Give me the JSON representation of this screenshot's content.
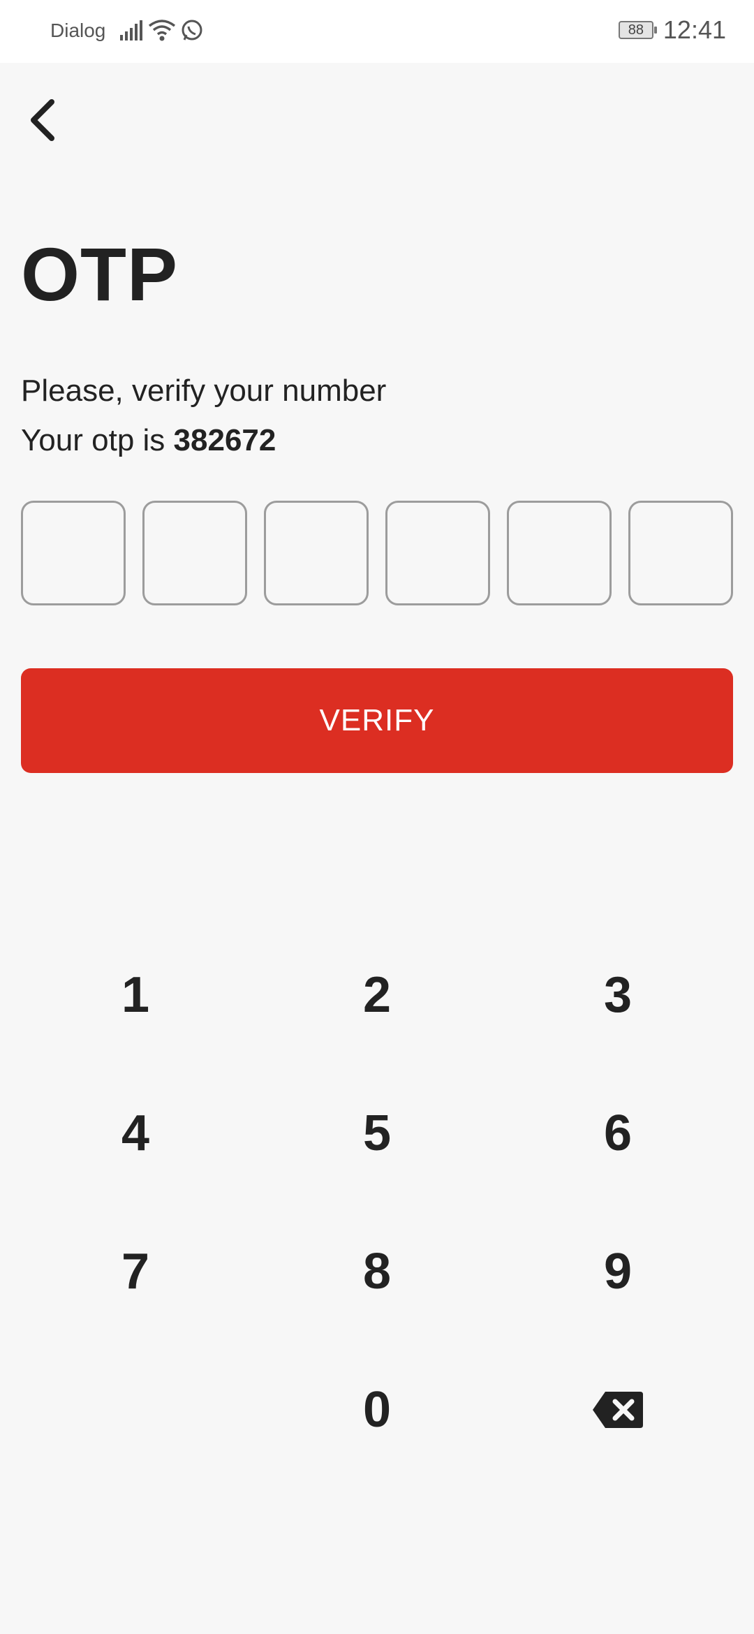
{
  "status_bar": {
    "carrier": "Dialog",
    "battery": "88",
    "time": "12:41",
    "icons": [
      "signal-icon",
      "wifi-icon",
      "whatsapp-icon"
    ]
  },
  "header": {
    "back_icon": "chevron-left-icon"
  },
  "main": {
    "title": "OTP",
    "subtitle": "Please, verify your number",
    "otp_prefix": "Your otp is ",
    "otp_code": "382672",
    "otp_boxes": [
      "",
      "",
      "",
      "",
      "",
      ""
    ],
    "verify_label": "VERIFY"
  },
  "keypad": {
    "keys": [
      "1",
      "2",
      "3",
      "4",
      "5",
      "6",
      "7",
      "8",
      "9",
      "0"
    ],
    "backspace_icon": "backspace-icon"
  },
  "colors": {
    "accent": "#dc2e22",
    "background": "#f7f7f7",
    "text": "#222222"
  }
}
